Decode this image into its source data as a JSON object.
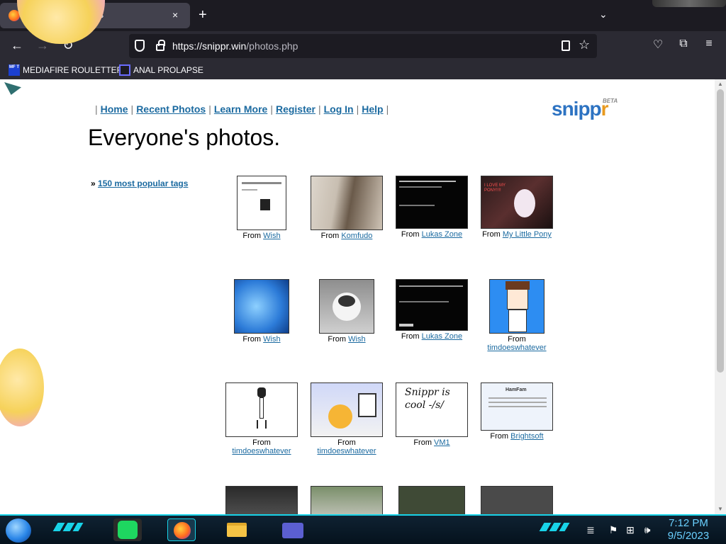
{
  "browser": {
    "tab_title": "s",
    "new_tab": "+",
    "close": "×",
    "tab_list": "⌄",
    "url": {
      "host": "https://snippr.win",
      "path": "/photos.php"
    },
    "bookmarks": [
      {
        "label": "MEDIAFIRE ROULETTER",
        "icon_text": "MF T"
      },
      {
        "label": "ANAL PROLAPSE"
      }
    ]
  },
  "page": {
    "nav": [
      "Home",
      "Recent Photos",
      "Learn More",
      "Register",
      "Log In",
      "Help"
    ],
    "logo": {
      "main": "snipp",
      "accent": "r",
      "beta": "BETA"
    },
    "title": "Everyone's photos.",
    "tags_link": {
      "prefix": "»",
      "label": "150 most popular tags"
    },
    "from_label": "From",
    "photos": [
      {
        "source": "Wish"
      },
      {
        "source": "Komfudo"
      },
      {
        "source": "Lukas Zone"
      },
      {
        "source": "My Little Pony",
        "caption": "I LOVE MY PONY!!!!"
      },
      {
        "source": "Wish"
      },
      {
        "source": "Wish"
      },
      {
        "source": "Lukas Zone"
      },
      {
        "source": "timdoeswhatever"
      },
      {
        "source": "timdoeswhatever"
      },
      {
        "source": "timdoeswhatever"
      },
      {
        "source": "VM1",
        "caption": "Snippr is cool -/s/"
      },
      {
        "source": "Brightsoft",
        "caption": "HamFam"
      }
    ]
  },
  "taskbar": {
    "time": "7:12 PM",
    "date": "9/5/2023"
  }
}
